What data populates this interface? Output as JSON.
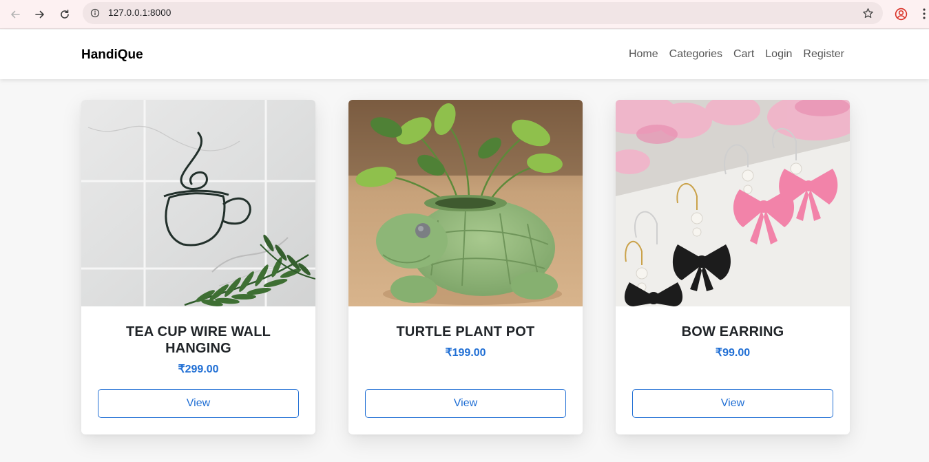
{
  "browser": {
    "url": "127.0.0.1:8000"
  },
  "navbar": {
    "brand": "HandiQue",
    "links": [
      "Home",
      "Categories",
      "Cart",
      "Login",
      "Register"
    ]
  },
  "products": [
    {
      "title": "TEA CUP WIRE WALL HANGING",
      "price": "₹299.00",
      "button": "View",
      "image": "tea-cup-wire-art"
    },
    {
      "title": "TURTLE PLANT POT",
      "price": "₹199.00",
      "button": "View",
      "image": "turtle-planter"
    },
    {
      "title": "BOW EARRING",
      "price": "₹99.00",
      "button": "View",
      "image": "bow-earrings"
    }
  ],
  "colors": {
    "accent": "#1f6ed4",
    "chrome_bg": "#fdf1f2",
    "profile": "#d93025"
  }
}
